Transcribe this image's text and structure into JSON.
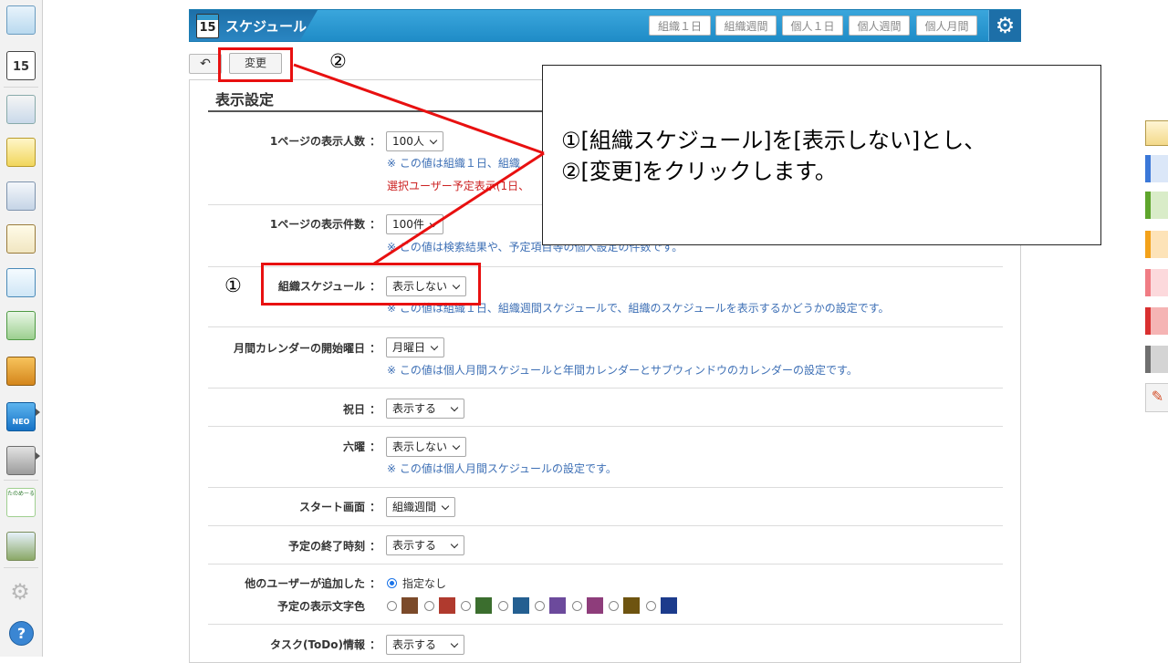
{
  "header": {
    "calendar_icon_number": "15",
    "title": "スケジュール",
    "nav": [
      {
        "label": "組織１日"
      },
      {
        "label": "組織週間"
      },
      {
        "label": "個人１日"
      },
      {
        "label": "個人週間"
      },
      {
        "label": "個人月間"
      }
    ]
  },
  "toolbar": {
    "back_icon": "↶",
    "change_label": "変更"
  },
  "sidebar": {
    "calendar_icon_number": "15",
    "neo_label": "NEO",
    "app_badge_text": "たのめーる"
  },
  "panel": {
    "title": "表示設定",
    "colon": "：",
    "rows": [
      {
        "label": "1ページの表示人数",
        "value": "100人",
        "notes": [
          "※ この値は組織１日、組織"
        ],
        "red_note": "選択ユーザー予定表示(1日、"
      },
      {
        "label": "1ページの表示件数",
        "value": "100件",
        "notes": [
          "※ この値は検索結果や、予定項目等の個人設定の件数です。"
        ]
      },
      {
        "label": "組織スケジュール",
        "value": "表示しない",
        "notes": [
          "※ この値は組織１日、組織週間スケジュールで、組織のスケジュールを表示するかどうかの設定です。"
        ]
      },
      {
        "label": "月間カレンダーの開始曜日",
        "value": "月曜日",
        "notes": [
          "※ この値は個人月間スケジュールと年間カレンダーとサブウィンドウのカレンダーの設定です。"
        ]
      },
      {
        "label": "祝日",
        "value": "表示する",
        "notes": []
      },
      {
        "label": "六曜",
        "value": "表示しない",
        "notes": [
          "※ この値は個人月間スケジュールの設定です。"
        ]
      },
      {
        "label": "スタート画面",
        "value": "組織週間",
        "notes": []
      },
      {
        "label": "予定の終了時刻",
        "value": "表示する",
        "notes": []
      },
      {
        "label": "他のユーザーが追加した",
        "label2": "予定の表示文字色",
        "radio_default": "指定なし",
        "notes": []
      },
      {
        "label": "タスク(ToDo)情報",
        "value": "表示する",
        "notes": []
      }
    ]
  },
  "color_swatches": [
    "#7b4a2a",
    "#b03a2e",
    "#3b6e2e",
    "#245f91",
    "#6c4a9c",
    "#8e3d7b",
    "#6e5410",
    "#1c3b8c"
  ],
  "annotations": {
    "marker_1": "①",
    "marker_2": "②",
    "callout_line1": "①[組織スケジュール]を[表示しない]とし、",
    "callout_line2": "②[変更]をクリックします。",
    "highlight_color": "#e81010"
  }
}
